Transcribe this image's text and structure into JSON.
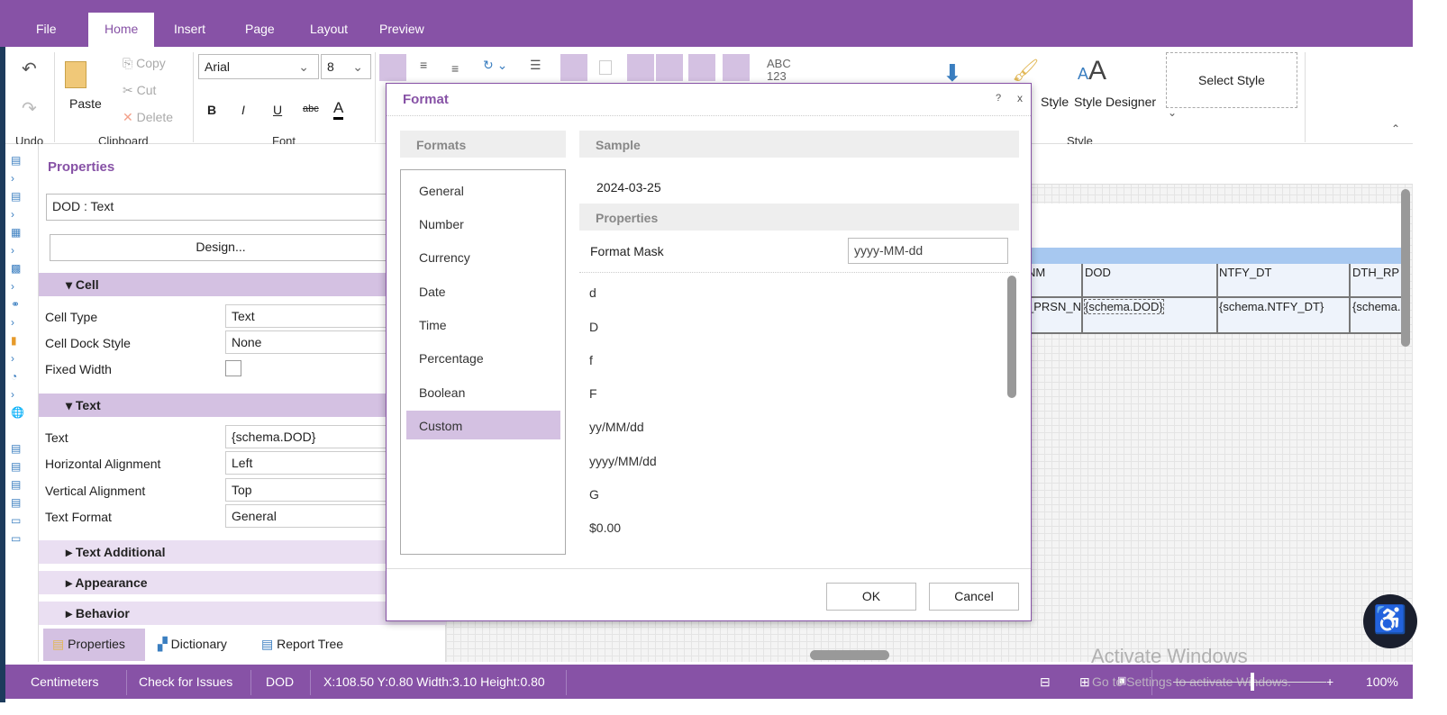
{
  "menu": {
    "tabs": [
      "File",
      "Home",
      "Insert",
      "Page",
      "Layout",
      "Preview"
    ],
    "active": "Home"
  },
  "ribbon": {
    "undo": {
      "label": "Undo"
    },
    "clipboard": {
      "label": "Clipboard",
      "paste": "Paste",
      "copy": "Copy",
      "cut": "Cut",
      "delete": "Delete"
    },
    "font": {
      "label": "Font",
      "family": "Arial",
      "size": "8",
      "bold": "B",
      "italic": "I",
      "underline": "U",
      "strike": "abc",
      "color": "A"
    },
    "abc": "ABC",
    "n123": "123",
    "style": {
      "label": "Style",
      "style_btn": "Style",
      "designer": "Style Designer",
      "select_style": "Select Style"
    }
  },
  "properties": {
    "title": "Properties",
    "component": "DOD : Text",
    "design": "Design...",
    "sections": {
      "cell": "Cell",
      "text": "Text",
      "text_additional": "Text Additional",
      "appearance": "Appearance",
      "behavior": "Behavior"
    },
    "cell": [
      {
        "label": "Cell Type",
        "value": "Text"
      },
      {
        "label": "Cell Dock Style",
        "value": "None"
      },
      {
        "label": "Fixed Width",
        "value": ""
      }
    ],
    "text": [
      {
        "label": "Text",
        "value": "{schema.DOD}"
      },
      {
        "label": "Horizontal Alignment",
        "value": "Left"
      },
      {
        "label": "Vertical Alignment",
        "value": "Top"
      },
      {
        "label": "Text Format",
        "value": "General"
      }
    ],
    "tabs": [
      "Properties",
      "Dictionary",
      "Report Tree"
    ]
  },
  "canvas": {
    "headers": [
      "NM",
      "DOD",
      "NTFY_DT",
      "DTH_RP"
    ],
    "cells": [
      "_PRSN_N",
      "{schema.DOD}",
      "{schema.NTFY_DT}",
      "{schema."
    ]
  },
  "dialog": {
    "title": "Format",
    "help": "?",
    "close": "x",
    "formats_header": "Formats",
    "sample_header": "Sample",
    "sample": "2024-03-25",
    "properties_header": "Properties",
    "mask_label": "Format Mask",
    "mask_value": "yyyy-MM-dd",
    "formats": [
      "General",
      "Number",
      "Currency",
      "Date",
      "Time",
      "Percentage",
      "Boolean",
      "Custom"
    ],
    "selected": "Custom",
    "masks": [
      "d",
      "D",
      "f",
      "F",
      "yy/MM/dd",
      "yyyy/MM/dd",
      "G",
      "$0.00"
    ],
    "ok": "OK",
    "cancel": "Cancel"
  },
  "status": {
    "units": "Centimeters",
    "check": "Check for Issues",
    "component": "DOD",
    "position": "X:108.50 Y:0.80 Width:3.10 Height:0.80",
    "zoom": "100%"
  },
  "watermark": {
    "line1": "Activate Windows",
    "line2": "Go to Settings to activate Windows."
  },
  "colors": {
    "accent": "#8752a6",
    "highlight": "#d4c1e2"
  }
}
